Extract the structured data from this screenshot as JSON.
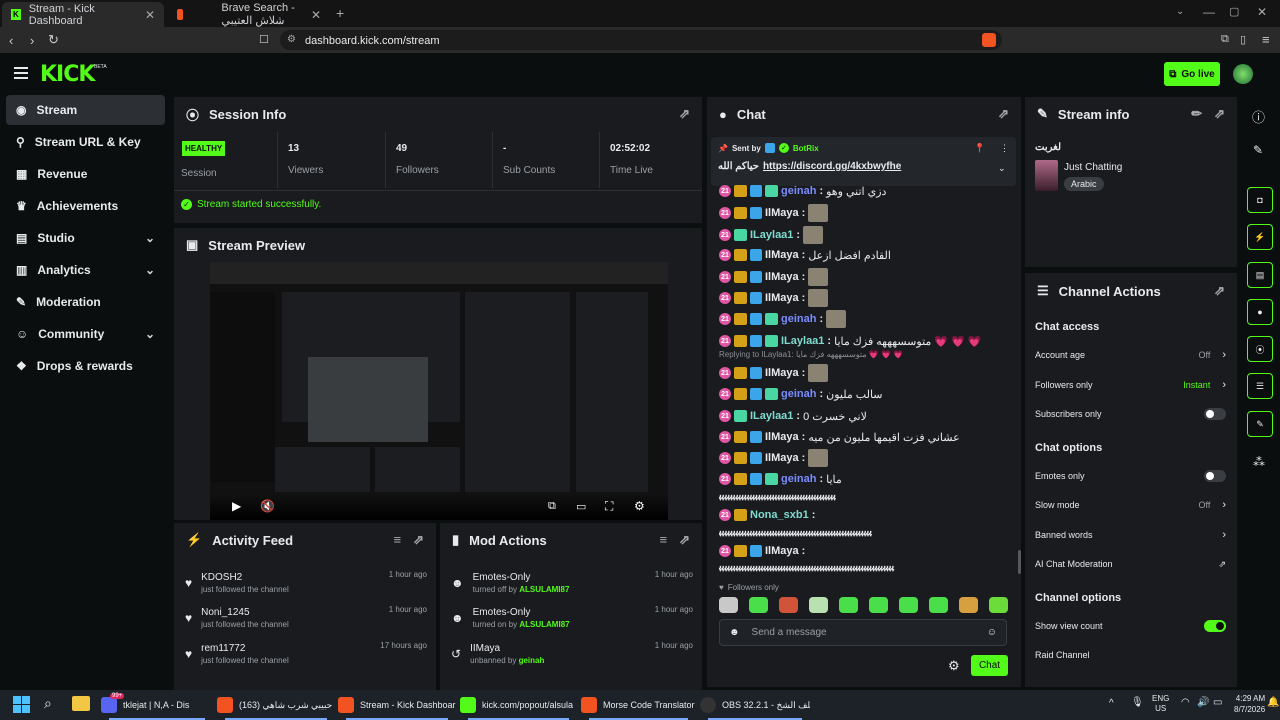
{
  "browser": {
    "tabs": [
      {
        "title": "Stream - Kick Dashboard",
        "active": true
      },
      {
        "title": "Brave Search - شلاش العتيبي",
        "active": false
      }
    ],
    "url": "dashboard.kick.com/stream"
  },
  "header": {
    "logo": "KICK",
    "beta": "BETA",
    "go_live": "Go live"
  },
  "sidebar": {
    "items": [
      {
        "label": "Stream",
        "icon": "broadcast-icon",
        "active": true
      },
      {
        "label": "Stream URL & Key",
        "icon": "link-icon"
      },
      {
        "label": "Revenue",
        "icon": "chart-icon"
      },
      {
        "label": "Achievements",
        "icon": "trophy-icon"
      },
      {
        "label": "Studio",
        "icon": "studio-icon",
        "expandable": true
      },
      {
        "label": "Analytics",
        "icon": "analytics-icon",
        "expandable": true
      },
      {
        "label": "Moderation",
        "icon": "wrench-icon"
      },
      {
        "label": "Community",
        "icon": "people-icon",
        "expandable": true
      },
      {
        "label": "Drops & rewards",
        "icon": "gift-icon"
      }
    ]
  },
  "session": {
    "title": "Session Info",
    "status": "HEALTHY",
    "status_label": "Session",
    "stats": [
      {
        "value": "13",
        "label": "Viewers"
      },
      {
        "value": "49",
        "label": "Followers"
      },
      {
        "value": "-",
        "label": "Sub Counts"
      },
      {
        "value": "02:52:02",
        "label": "Time Live"
      }
    ],
    "message": "Stream started successfully."
  },
  "preview": {
    "title": "Stream Preview"
  },
  "activity": {
    "title": "Activity Feed",
    "items": [
      {
        "name": "KDOSH2",
        "desc": "just followed the channel",
        "time": "1 hour ago"
      },
      {
        "name": "Noni_1245",
        "desc": "just followed the channel",
        "time": "1 hour ago"
      },
      {
        "name": "rem11772",
        "desc": "just followed the channel",
        "time": "17 hours ago"
      }
    ]
  },
  "mod_actions": {
    "title": "Mod Actions",
    "items": [
      {
        "title": "Emotes-Only",
        "prefix": "turned off by",
        "user": "ALSULAMI87",
        "time": "1 hour ago"
      },
      {
        "title": "Emotes-Only",
        "prefix": "turned on by",
        "user": "ALSULAMI87",
        "time": "1 hour ago"
      },
      {
        "title": "IIMaya",
        "prefix": "unbanned by",
        "user": "geinah",
        "time": "1 hour ago"
      }
    ]
  },
  "chat": {
    "title": "Chat",
    "pinned": {
      "sent_by": "Sent by",
      "user": "BotRix",
      "text_prefix": "حياكم الله",
      "link": "https://discord.gg/4kxbwyfhe"
    },
    "messages": [
      {
        "user": "geinah",
        "text": "دزي اتني وهو",
        "color": "#7b8cff",
        "badges": [
          "21",
          "crown",
          "blue",
          "green"
        ]
      },
      {
        "user": "IlMaya",
        "text": "",
        "color": "#e8eaed",
        "badges": [
          "21",
          "crown",
          "blue"
        ],
        "thumb": true
      },
      {
        "user": "ILaylaa1",
        "text": "",
        "color": "#7fdbd0",
        "badges": [
          "21",
          "green"
        ],
        "thumb": true
      },
      {
        "user": "IlMaya",
        "text": "القادم افضل ازعل",
        "color": "#e8eaed",
        "badges": [
          "21",
          "crown",
          "blue"
        ]
      },
      {
        "user": "IlMaya",
        "text": "",
        "color": "#e8eaed",
        "badges": [
          "21",
          "crown",
          "blue"
        ],
        "thumb": true
      },
      {
        "user": "IlMaya",
        "text": "",
        "color": "#e8eaed",
        "badges": [
          "21",
          "crown",
          "blue"
        ],
        "thumb": true
      },
      {
        "user": "geinah",
        "text": "",
        "color": "#7b8cff",
        "badges": [
          "21",
          "crown",
          "blue",
          "green"
        ],
        "thumb": true
      },
      {
        "user": "ILaylaa1",
        "text": "متوسسهههه فزك مايا 💗 💗 💗",
        "color": "#7fdbd0",
        "badges": [
          "21",
          "crown",
          "blue",
          "green"
        ]
      },
      {
        "user": "IlMaya",
        "text": "",
        "color": "#e8eaed",
        "badges": [
          "21",
          "crown",
          "blue"
        ],
        "thumb": true,
        "reply": "Replying to ILaylaa1: متوسسهههه فزك مايا 💗 💗 💗"
      },
      {
        "user": "geinah",
        "text": "سالب مليون",
        "color": "#7b8cff",
        "badges": [
          "21",
          "crown",
          "blue",
          "green"
        ]
      },
      {
        "user": "ILaylaa1",
        "text": "لاني خسرت 0",
        "color": "#7fdbd0",
        "badges": [
          "21",
          "green"
        ]
      },
      {
        "user": "IlMaya",
        "text": "عشاني فزت اقيمها مليون من ميه",
        "color": "#e8eaed",
        "badges": [
          "21",
          "crown",
          "blue"
        ]
      },
      {
        "user": "IlMaya",
        "text": "",
        "color": "#e8eaed",
        "badges": [
          "21",
          "crown",
          "blue"
        ],
        "thumb": true
      },
      {
        "user": "geinah",
        "text": "مايا",
        "color": "#7b8cff",
        "badges": [
          "21",
          "crown",
          "blue",
          "green"
        ]
      }
    ],
    "long_line_1": "ﭘﭘﭘﭘﭘﭘﭘﭘﭘﭘﭘﭘﭘﭘﭘﭘﭘﭘﭘﭘﭘﭘﭘﭘﭘﭘﭘﭘﭘﭘﭘﭘﭘﭘﭘﭘﭘﭘﭘﭘﭘﭘ",
    "nona": {
      "user": "Nona_sxb1",
      "color": "#7fdbd0"
    },
    "long_line_2": "ﭘﭘﭘﭘﭘﭘﭘﭘﭘﭘﭘﭘﭘﭘﭘﭘﭘﭘﭘﭘﭘﭘﭘﭘﭘﭘﭘﭘﭘﭘﭘﭘﭘﭘﭘﭘﭘﭘﭘﭘﭘﭘﭘﭘﭘﭘﭘﭘﭘﭘﭘﭘﭘﭘﭘ",
    "last_user": "IlMaya",
    "long_line_3": "ﭘﭘﭘﭘﭘﭘﭘﭘﭘﭘﭘﭘﭘﭘﭘﭘﭘﭘﭘﭘﭘﭘﭘﭘﭘﭘﭘﭘﭘﭘﭘﭘﭘﭘﭘﭘﭘﭘﭘﭘﭘﭘﭘﭘﭘﭘﭘﭘﭘﭘﭘﭘﭘﭘﭘﭘﭘﭘﭘﭘﭘﭘﭘ",
    "followers_only": "Followers only",
    "placeholder": "Send a message",
    "send": "Chat"
  },
  "stream_info": {
    "title": "Stream info",
    "stream_title": "لغربت",
    "category": "Just Chatting",
    "tag": "Arabic"
  },
  "channel_actions": {
    "title": "Channel Actions",
    "sections": {
      "access": "Chat access",
      "options": "Chat options",
      "channel": "Channel options"
    },
    "account_age": {
      "label": "Account age",
      "value": "Off"
    },
    "followers_only": {
      "label": "Followers only",
      "value": "Instant"
    },
    "subscribers_only": {
      "label": "Subscribers only"
    },
    "emotes_only": {
      "label": "Emotes only"
    },
    "slow_mode": {
      "label": "Slow mode",
      "value": "Off"
    },
    "banned_words": {
      "label": "Banned words"
    },
    "ai_mod": {
      "label": "AI Chat Moderation"
    },
    "view_count": {
      "label": "Show view count"
    },
    "raid": {
      "label": "Raid Channel"
    }
  },
  "taskbar": {
    "items": [
      {
        "label": "tklejat | N,A - Dis",
        "badge": "99+"
      },
      {
        "label": "(163) حبيبي شرب شاهي"
      },
      {
        "label": "Stream - Kick Dashboar"
      },
      {
        "label": "kick.com/popout/alsula"
      },
      {
        "label": "Morse Code Translator"
      },
      {
        "label": "OBS 32.2.1 - الملف الشخ"
      }
    ],
    "lang": "ENG",
    "region": "US",
    "time": "4:29 AM",
    "date": "8/7/2026"
  },
  "colors": {
    "accent": "#53fc18",
    "panel": "#191b1f",
    "bg": "#0b0e0f"
  }
}
